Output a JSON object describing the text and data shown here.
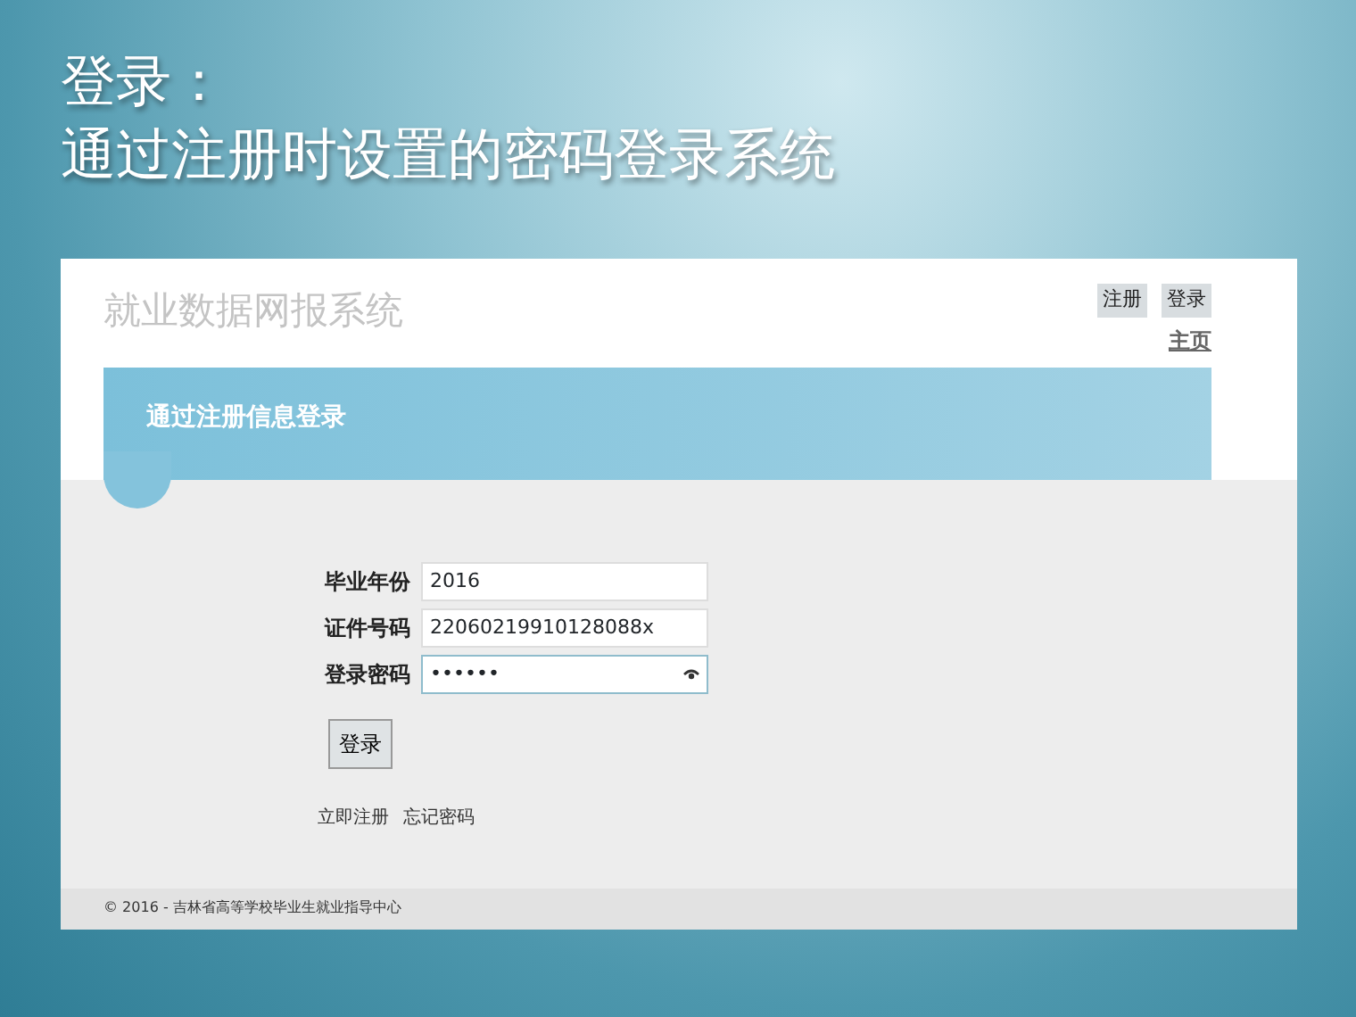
{
  "slide": {
    "title_lines": [
      "登录：",
      "通过注册时设置的密码登录系统"
    ]
  },
  "site": {
    "title": "就业数据网报系统",
    "nav_buttons": [
      "注册",
      "登录"
    ],
    "home_link": "主页",
    "banner": "通过注册信息登录",
    "fields": [
      {
        "label": "毕业年份",
        "value": "2016",
        "kind": "text",
        "focused": false
      },
      {
        "label": "证件号码",
        "value": "22060219910128088x",
        "kind": "text",
        "focused": false
      },
      {
        "label": "登录密码",
        "value": "••••••",
        "kind": "password",
        "focused": true
      }
    ],
    "submit": "登录",
    "links": [
      "立即注册",
      "忘记密码"
    ],
    "footer": "© 2016 - 吉林省高等学校毕业生就业指导中心"
  }
}
